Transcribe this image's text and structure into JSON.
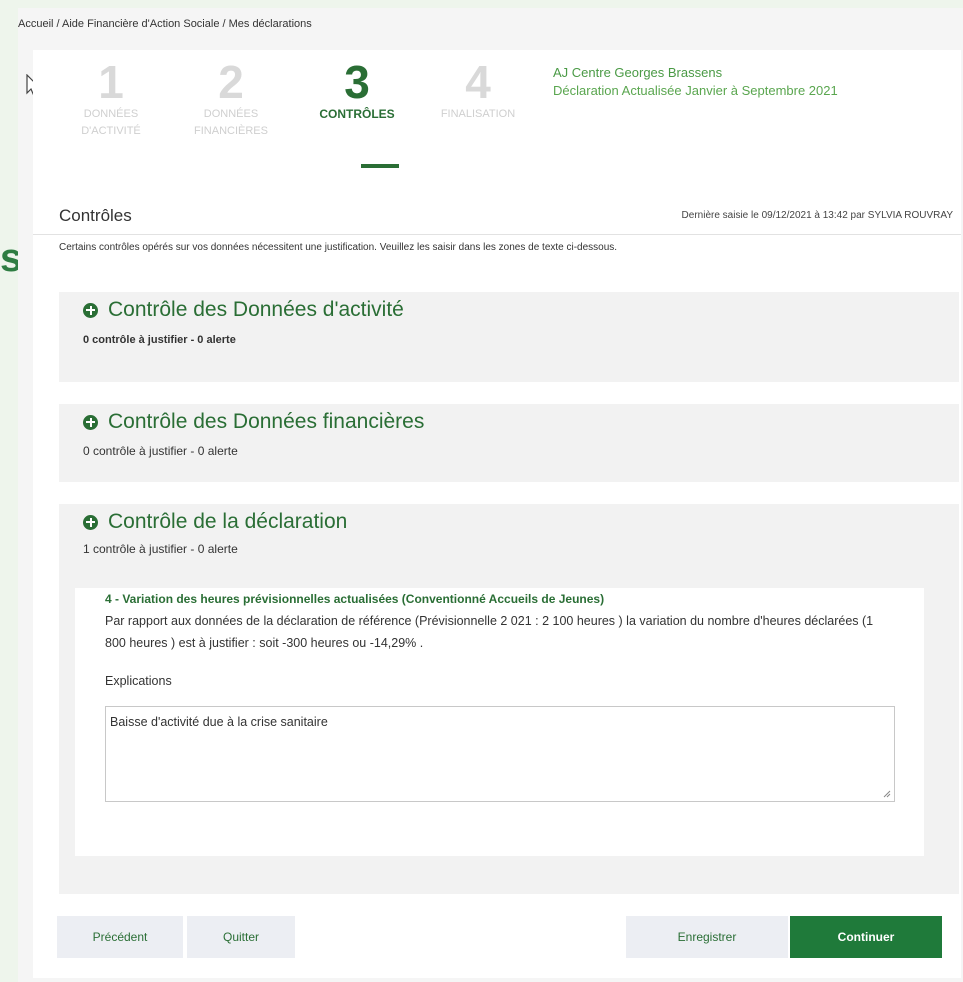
{
  "breadcrumb": "Accueil / Aide Financière d'Action Sociale / Mes déclarations",
  "side_letter": "s",
  "steps": [
    {
      "number": "1",
      "label_line1": "DONNÉES",
      "label_line2": "D'ACTIVITÉ"
    },
    {
      "number": "2",
      "label_line1": "DONNÉES",
      "label_line2": "FINANCIÈRES"
    },
    {
      "number": "3",
      "label_line1": "CONTRÔLES",
      "label_line2": ""
    },
    {
      "number": "4",
      "label_line1": "FINALISATION",
      "label_line2": ""
    }
  ],
  "active_step": 3,
  "declaration": {
    "organisation": "AJ Centre Georges Brassens",
    "title": "Déclaration Actualisée Janvier à Septembre 2021"
  },
  "section": {
    "title": "Contrôles",
    "last_entry": "Dernière saisie le 09/12/2021 à 13:42 par SYLVIA ROUVRAY",
    "intro": "Certains contrôles opérés sur vos données nécessitent une justification. Veuillez les saisir dans les zones de texte ci-dessous."
  },
  "blocks": [
    {
      "title": "Contrôle des Données d'activité",
      "summary": "0 contrôle à justifier - 0 alerte"
    },
    {
      "title": "Contrôle des Données financières",
      "summary": "0 contrôle à justifier - 0 alerte"
    },
    {
      "title": "Contrôle de la déclaration",
      "summary": "1 contrôle à justifier - 0 alerte"
    }
  ],
  "control": {
    "title": "4 - Variation des heures prévisionnelles actualisées (Conventionné Accueils de Jeunes)",
    "text": "Par rapport aux données de la déclaration de référence (Prévisionnelle 2 021 : 2 100 heures ) la variation du nombre d'heures déclarées (1 800 heures ) est à justifier : soit -300 heures ou -14,29% .",
    "explanations_label": "Explications",
    "explanations_value": "Baisse d'activité due à la crise sanitaire"
  },
  "buttons": {
    "previous": "Précédent",
    "quit": "Quitter",
    "save": "Enregistrer",
    "continue": "Continuer"
  },
  "colors": {
    "accent": "#2a6e35",
    "primary_button": "#1f7a3a",
    "org_text": "#5aa64f"
  }
}
